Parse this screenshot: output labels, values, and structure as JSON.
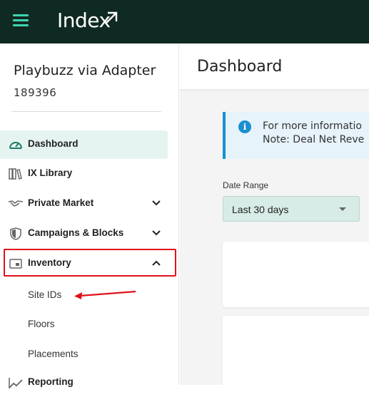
{
  "topbar": {
    "brand": "Index",
    "colors": {
      "background": "#0f2a22",
      "accent": "#3fd3b3"
    }
  },
  "account": {
    "name": "Playbuzz via Adapter",
    "id": "189396"
  },
  "sidebar": {
    "items": [
      {
        "label": "Dashboard",
        "icon": "gauge-icon",
        "active": true
      },
      {
        "label": "IX Library",
        "icon": "library-icon"
      },
      {
        "label": "Private Market",
        "icon": "handshake-icon",
        "expandable": true
      },
      {
        "label": "Campaigns & Blocks",
        "icon": "shield-icon",
        "expandable": true
      },
      {
        "label": "Inventory",
        "icon": "inventory-icon",
        "expanded": true,
        "highlighted": true,
        "children": [
          "Site IDs",
          "Floors",
          "Placements"
        ]
      },
      {
        "label": "Reporting",
        "icon": "chart-icon"
      }
    ]
  },
  "main": {
    "title": "Dashboard",
    "info_banner": {
      "line1": "For more informatio",
      "line2": "Note: Deal Net Reve"
    },
    "date_range": {
      "label": "Date Range",
      "value": "Last 30 days"
    }
  },
  "annotation": {
    "highlight_color": "#e0121a"
  }
}
